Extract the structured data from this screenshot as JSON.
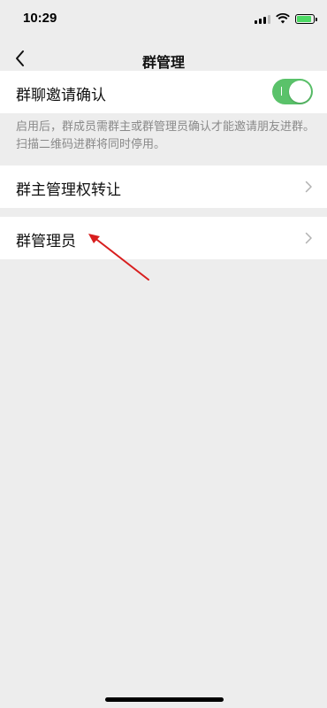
{
  "status_bar": {
    "time": "10:29",
    "signal_icon": "cellular-signal-icon",
    "wifi_icon": "wifi-icon",
    "battery_icon": "battery-charging-icon"
  },
  "nav": {
    "title": "群管理",
    "back_icon": "chevron-left-icon"
  },
  "settings": {
    "invite_confirm": {
      "label": "群聊邀请确认",
      "toggle_on": true,
      "description": "启用后，群成员需群主或群管理员确认才能邀请朋友进群。扫描二维码进群将同时停用。"
    },
    "transfer_owner": {
      "label": "群主管理权转让",
      "icon": "chevron-right-icon"
    },
    "admins": {
      "label": "群管理员",
      "icon": "chevron-right-icon"
    }
  },
  "colors": {
    "background": "#ededed",
    "toggle_on": "#5ac26a",
    "annotation_arrow": "#d81e1e",
    "description_text": "#8a8a8a"
  }
}
